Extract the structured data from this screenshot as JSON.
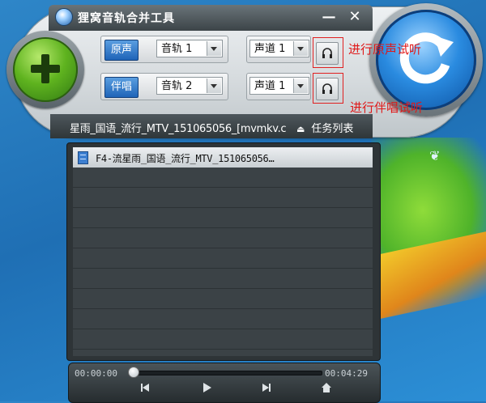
{
  "window": {
    "title": "狸窝音轨合并工具",
    "minimize_label": "—",
    "close_label": "✕"
  },
  "tracks": {
    "original": {
      "tag": "原声",
      "track_value": "音轨 1",
      "channel_value": "声道 1"
    },
    "accompaniment": {
      "tag": "伴唱",
      "track_value": "音轨 2",
      "channel_value": "声道 1"
    }
  },
  "annotations": {
    "original_preview": "进行原声试听",
    "accompaniment_preview": "进行伴唱试听"
  },
  "file": {
    "current_name": "星雨_国语_流行_MTV_151065056_[mvmkv.c",
    "task_list_label": "任务列表"
  },
  "list": {
    "items": [
      {
        "label": "F4-流星雨_国语_流行_MTV_151065056…"
      }
    ]
  },
  "player": {
    "current_time": "00:00:00",
    "total_time": "00:04:29",
    "progress": 0
  },
  "icons": {
    "add": "plus-icon",
    "merge": "refresh-arrow-icon",
    "preview": "headphones-icon",
    "task_list": "eject-icon",
    "file": "file-icon",
    "prev": "skip-previous-icon",
    "play": "play-icon",
    "next": "skip-next-icon",
    "home": "home-icon"
  },
  "colors": {
    "accent_blue": "#1f64b8",
    "add_green": "#5fb31f",
    "annotation_red": "#e01818"
  }
}
